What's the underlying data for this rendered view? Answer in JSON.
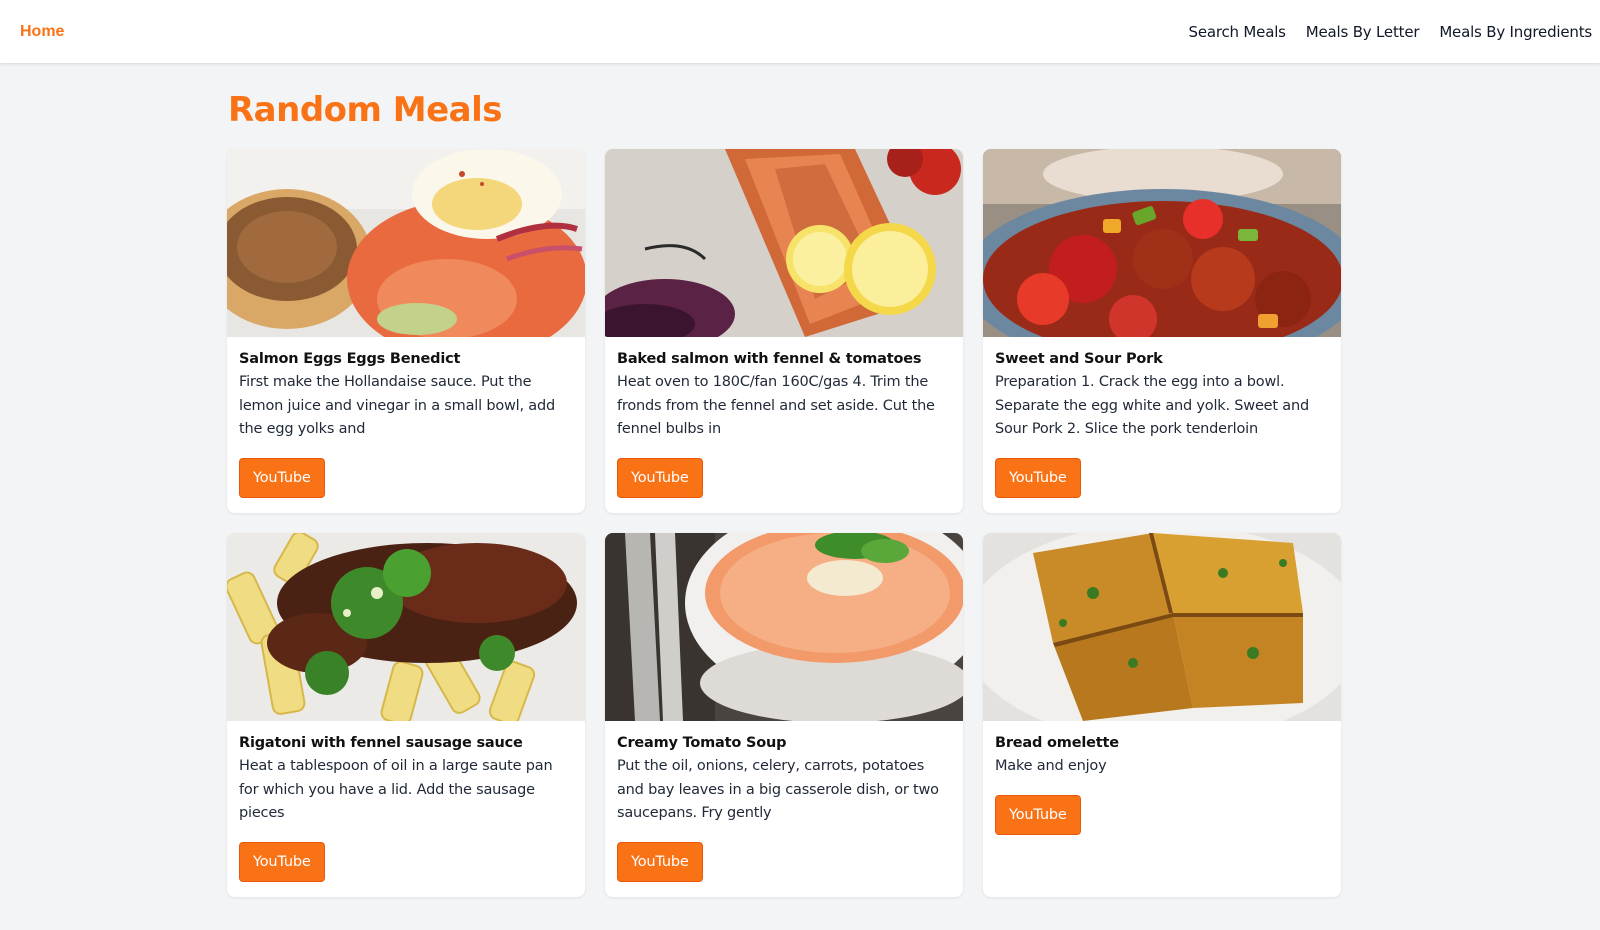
{
  "nav": {
    "home": "Home",
    "links": [
      "Search Meals",
      "Meals By Letter",
      "Meals By Ingredients"
    ]
  },
  "page": {
    "title": "Random Meals"
  },
  "accent_color": "#f97316",
  "meals": [
    {
      "title": "Salmon Eggs Eggs Benedict",
      "desc": "First make the Hollandaise sauce. Put the lemon juice and vinegar in a small bowl, add the egg yolks and",
      "button": "YouTube",
      "image": "salmon-eggs-benedict-photo"
    },
    {
      "title": "Baked salmon with fennel & tomatoes",
      "desc": "Heat oven to 180C/fan 160C/gas 4. Trim the fronds from the fennel and set aside. Cut the fennel bulbs in",
      "button": "YouTube",
      "image": "baked-salmon-photo"
    },
    {
      "title": "Sweet and Sour Pork",
      "desc": "Preparation 1. Crack the egg into a bowl. Separate the egg white and yolk. Sweet and Sour Pork 2. Slice the pork tenderloin",
      "button": "YouTube",
      "image": "sweet-sour-pork-photo"
    },
    {
      "title": "Rigatoni with fennel sausage sauce",
      "desc": "Heat a tablespoon of oil in a large saute pan for which you have a lid. Add the sausage pieces",
      "button": "YouTube",
      "image": "rigatoni-photo"
    },
    {
      "title": "Creamy Tomato Soup",
      "desc": "Put the oil, onions, celery, carrots, potatoes and bay leaves in a big casserole dish, or two saucepans. Fry gently",
      "button": "YouTube",
      "image": "tomato-soup-photo"
    },
    {
      "title": "Bread omelette",
      "desc": "Make and enjoy",
      "button": "YouTube",
      "image": "bread-omelette-photo"
    }
  ]
}
